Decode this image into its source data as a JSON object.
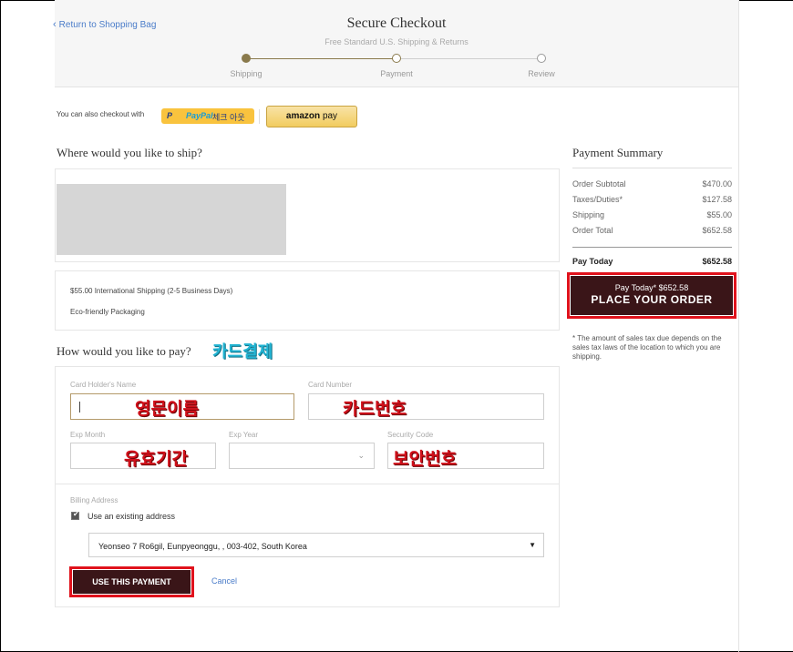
{
  "header": {
    "back_link": "Return to Shopping Bag",
    "title": "Secure Checkout",
    "subtitle": "Free Standard U.S. Shipping & Returns",
    "steps": [
      {
        "label": "Shipping",
        "state": "done"
      },
      {
        "label": "Payment",
        "state": "active"
      },
      {
        "label": "Review",
        "state": "pending"
      }
    ],
    "accent_color": "#8a7a4c"
  },
  "express": {
    "label": "You can also checkout with",
    "paypal_text_1": "P",
    "paypal_text_2": "PayPal",
    "paypal_text_3": "체크 아웃",
    "amazon_text_1": "amazon",
    "amazon_text_2": "pay"
  },
  "shipping": {
    "title": "Where would you like to ship?",
    "method": "$55.00 International Shipping (2-5 Business Days)",
    "packaging": "Eco-friendly Packaging"
  },
  "payment": {
    "title": "How would you like to pay?",
    "card_holder_label": "Card Holder's Name",
    "card_number_label": "Card Number",
    "exp_month_label": "Exp Month",
    "exp_year_label": "Exp Year",
    "security_code_label": "Security Code",
    "billing_label": "Billing Address",
    "use_existing_label": "Use an existing address",
    "use_existing_checked": true,
    "selected_address": "Yeonseo 7 Ro6gil, Eunpyeonggu, , 003-402, South Korea",
    "use_payment_button": "USE THIS PAYMENT",
    "cancel_link": "Cancel"
  },
  "annotations": {
    "card_payment": "카드결제",
    "english_name": "영문이름",
    "card_number": "카드번호",
    "expiry": "유효기간",
    "security": "보안번호",
    "cyan_color": "#22b5d4",
    "red_color": "#d0101a"
  },
  "summary": {
    "title": "Payment Summary",
    "rows": [
      {
        "label": "Order Subtotal",
        "value": "$470.00"
      },
      {
        "label": "Taxes/Duties*",
        "value": "$127.58"
      },
      {
        "label": "Shipping",
        "value": "$55.00"
      },
      {
        "label": "Order Total",
        "value": "$652.58"
      }
    ],
    "pay_today_label": "Pay Today",
    "pay_today_value": "$652.58",
    "place_order_top": "Pay Today* $652.58",
    "place_order_main": "PLACE YOUR ORDER",
    "note": "* The amount of sales tax due depends on the sales tax laws of the location to which you are shipping.",
    "button_color": "#3a1518"
  }
}
